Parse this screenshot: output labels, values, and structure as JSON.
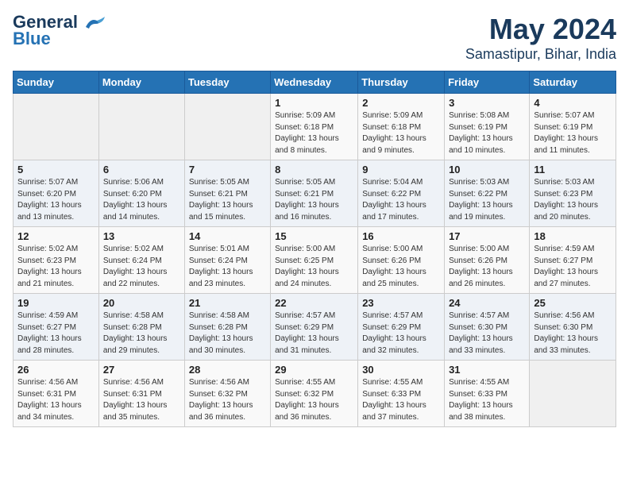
{
  "app": {
    "logo_line1": "General",
    "logo_line2": "Blue",
    "title": "May 2024",
    "subtitle": "Samastipur, Bihar, India"
  },
  "calendar": {
    "headers": [
      "Sunday",
      "Monday",
      "Tuesday",
      "Wednesday",
      "Thursday",
      "Friday",
      "Saturday"
    ],
    "weeks": [
      [
        {
          "day": "",
          "info": ""
        },
        {
          "day": "",
          "info": ""
        },
        {
          "day": "",
          "info": ""
        },
        {
          "day": "1",
          "info": "Sunrise: 5:09 AM\nSunset: 6:18 PM\nDaylight: 13 hours and 8 minutes."
        },
        {
          "day": "2",
          "info": "Sunrise: 5:09 AM\nSunset: 6:18 PM\nDaylight: 13 hours and 9 minutes."
        },
        {
          "day": "3",
          "info": "Sunrise: 5:08 AM\nSunset: 6:19 PM\nDaylight: 13 hours and 10 minutes."
        },
        {
          "day": "4",
          "info": "Sunrise: 5:07 AM\nSunset: 6:19 PM\nDaylight: 13 hours and 11 minutes."
        }
      ],
      [
        {
          "day": "5",
          "info": "Sunrise: 5:07 AM\nSunset: 6:20 PM\nDaylight: 13 hours and 13 minutes."
        },
        {
          "day": "6",
          "info": "Sunrise: 5:06 AM\nSunset: 6:20 PM\nDaylight: 13 hours and 14 minutes."
        },
        {
          "day": "7",
          "info": "Sunrise: 5:05 AM\nSunset: 6:21 PM\nDaylight: 13 hours and 15 minutes."
        },
        {
          "day": "8",
          "info": "Sunrise: 5:05 AM\nSunset: 6:21 PM\nDaylight: 13 hours and 16 minutes."
        },
        {
          "day": "9",
          "info": "Sunrise: 5:04 AM\nSunset: 6:22 PM\nDaylight: 13 hours and 17 minutes."
        },
        {
          "day": "10",
          "info": "Sunrise: 5:03 AM\nSunset: 6:22 PM\nDaylight: 13 hours and 19 minutes."
        },
        {
          "day": "11",
          "info": "Sunrise: 5:03 AM\nSunset: 6:23 PM\nDaylight: 13 hours and 20 minutes."
        }
      ],
      [
        {
          "day": "12",
          "info": "Sunrise: 5:02 AM\nSunset: 6:23 PM\nDaylight: 13 hours and 21 minutes."
        },
        {
          "day": "13",
          "info": "Sunrise: 5:02 AM\nSunset: 6:24 PM\nDaylight: 13 hours and 22 minutes."
        },
        {
          "day": "14",
          "info": "Sunrise: 5:01 AM\nSunset: 6:24 PM\nDaylight: 13 hours and 23 minutes."
        },
        {
          "day": "15",
          "info": "Sunrise: 5:00 AM\nSunset: 6:25 PM\nDaylight: 13 hours and 24 minutes."
        },
        {
          "day": "16",
          "info": "Sunrise: 5:00 AM\nSunset: 6:26 PM\nDaylight: 13 hours and 25 minutes."
        },
        {
          "day": "17",
          "info": "Sunrise: 5:00 AM\nSunset: 6:26 PM\nDaylight: 13 hours and 26 minutes."
        },
        {
          "day": "18",
          "info": "Sunrise: 4:59 AM\nSunset: 6:27 PM\nDaylight: 13 hours and 27 minutes."
        }
      ],
      [
        {
          "day": "19",
          "info": "Sunrise: 4:59 AM\nSunset: 6:27 PM\nDaylight: 13 hours and 28 minutes."
        },
        {
          "day": "20",
          "info": "Sunrise: 4:58 AM\nSunset: 6:28 PM\nDaylight: 13 hours and 29 minutes."
        },
        {
          "day": "21",
          "info": "Sunrise: 4:58 AM\nSunset: 6:28 PM\nDaylight: 13 hours and 30 minutes."
        },
        {
          "day": "22",
          "info": "Sunrise: 4:57 AM\nSunset: 6:29 PM\nDaylight: 13 hours and 31 minutes."
        },
        {
          "day": "23",
          "info": "Sunrise: 4:57 AM\nSunset: 6:29 PM\nDaylight: 13 hours and 32 minutes."
        },
        {
          "day": "24",
          "info": "Sunrise: 4:57 AM\nSunset: 6:30 PM\nDaylight: 13 hours and 33 minutes."
        },
        {
          "day": "25",
          "info": "Sunrise: 4:56 AM\nSunset: 6:30 PM\nDaylight: 13 hours and 33 minutes."
        }
      ],
      [
        {
          "day": "26",
          "info": "Sunrise: 4:56 AM\nSunset: 6:31 PM\nDaylight: 13 hours and 34 minutes."
        },
        {
          "day": "27",
          "info": "Sunrise: 4:56 AM\nSunset: 6:31 PM\nDaylight: 13 hours and 35 minutes."
        },
        {
          "day": "28",
          "info": "Sunrise: 4:56 AM\nSunset: 6:32 PM\nDaylight: 13 hours and 36 minutes."
        },
        {
          "day": "29",
          "info": "Sunrise: 4:55 AM\nSunset: 6:32 PM\nDaylight: 13 hours and 36 minutes."
        },
        {
          "day": "30",
          "info": "Sunrise: 4:55 AM\nSunset: 6:33 PM\nDaylight: 13 hours and 37 minutes."
        },
        {
          "day": "31",
          "info": "Sunrise: 4:55 AM\nSunset: 6:33 PM\nDaylight: 13 hours and 38 minutes."
        },
        {
          "day": "",
          "info": ""
        }
      ]
    ]
  }
}
